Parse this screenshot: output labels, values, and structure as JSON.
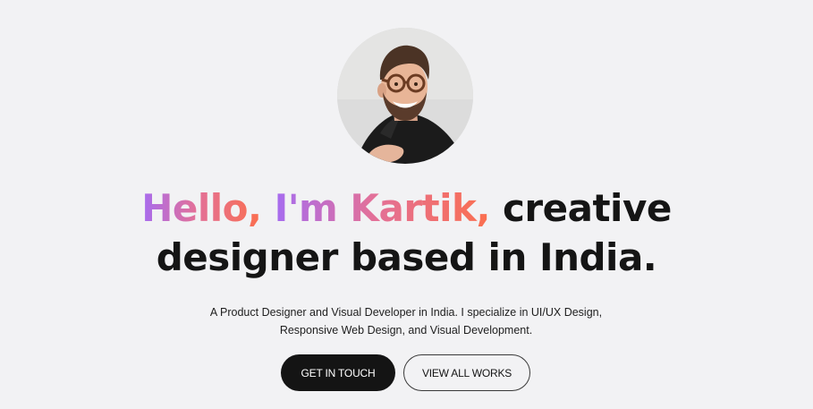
{
  "hero": {
    "avatar_alt": "Portrait of Kartik",
    "headline": {
      "highlight_1": "Hello,",
      "highlight_2": "I'm Kartik,",
      "rest_line_1": "creative",
      "line_2": "designer based in India."
    },
    "intro_line_1": "A Product Designer and Visual Developer in India. I specialize in UI/UX Design,",
    "intro_line_2": "Responsive Web Design, and Visual Development.",
    "primary_button": "GET IN TOUCH",
    "secondary_button": "VIEW ALL WORKS"
  },
  "colors": {
    "background": "#f2f2f4",
    "gradient_start": "#a66cf0",
    "gradient_mid": "#e2709a",
    "gradient_end": "#fb6f4e",
    "text": "#141414"
  }
}
